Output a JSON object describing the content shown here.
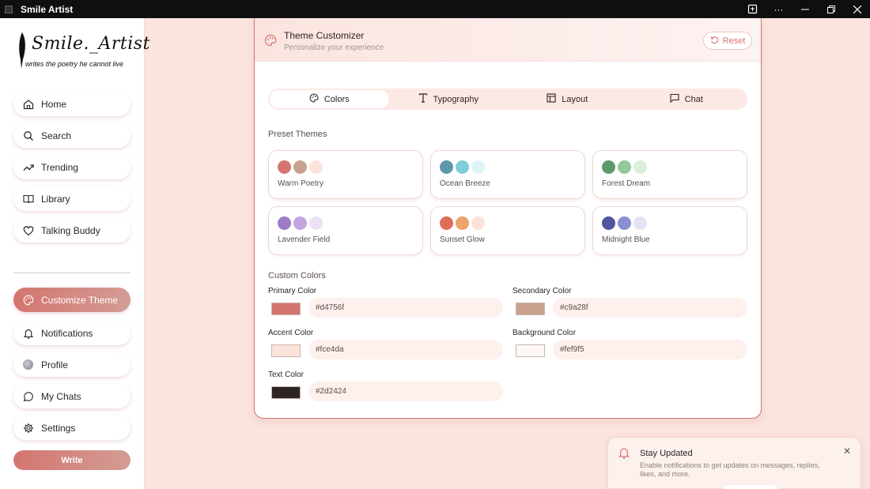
{
  "app": {
    "title": "Smile Artist"
  },
  "logo": {
    "main": "Smile._Artist",
    "tagline": "writes the poetry he cannot live"
  },
  "nav": [
    {
      "label": "Home",
      "icon": "home-icon"
    },
    {
      "label": "Search",
      "icon": "search-icon"
    },
    {
      "label": "Trending",
      "icon": "trending-icon"
    },
    {
      "label": "Library",
      "icon": "book-icon"
    },
    {
      "label": "Talking Buddy",
      "icon": "heart-icon"
    }
  ],
  "nav_bottom": [
    {
      "label": "Customize Theme",
      "icon": "palette-icon",
      "active": true
    },
    {
      "label": "Notifications",
      "icon": "bell-icon"
    },
    {
      "label": "Profile",
      "icon": "avatar"
    },
    {
      "label": "My Chats",
      "icon": "chat-icon"
    },
    {
      "label": "Settings",
      "icon": "gear-icon"
    }
  ],
  "write_label": "Write",
  "panel": {
    "title": "Theme Customizer",
    "subtitle": "Personalize your experience",
    "reset_label": "Reset",
    "tabs": [
      {
        "label": "Colors",
        "icon": "palette-icon",
        "active": true
      },
      {
        "label": "Typography",
        "icon": "type-icon"
      },
      {
        "label": "Layout",
        "icon": "layout-icon"
      },
      {
        "label": "Chat",
        "icon": "chat-icon"
      }
    ],
    "preset_heading": "Preset Themes",
    "presets": [
      {
        "name": "Warm Poetry",
        "colors": [
          "#d4756f",
          "#c9a28f",
          "#fce4da"
        ]
      },
      {
        "name": "Ocean Breeze",
        "colors": [
          "#5d98ad",
          "#7fcdd8",
          "#dff4f6"
        ]
      },
      {
        "name": "Forest Dream",
        "colors": [
          "#5e9a6c",
          "#93c79c",
          "#d9eedb"
        ]
      },
      {
        "name": "Lavender Field",
        "colors": [
          "#9e7cc7",
          "#c3a4df",
          "#ece0f6"
        ]
      },
      {
        "name": "Sunset Glow",
        "colors": [
          "#e06d58",
          "#eea36a",
          "#fce3d9"
        ]
      },
      {
        "name": "Midnight Blue",
        "colors": [
          "#5055a0",
          "#8a8fd1",
          "#e3e3f6"
        ]
      }
    ],
    "custom_heading": "Custom Colors",
    "custom": {
      "primary": {
        "label": "Primary Color",
        "value": "#d4756f"
      },
      "secondary": {
        "label": "Secondary Color",
        "value": "#c9a28f"
      },
      "accent": {
        "label": "Accent Color",
        "value": "#fce4da"
      },
      "background": {
        "label": "Background Color",
        "value": "#fef9f5"
      },
      "text": {
        "label": "Text Color",
        "value": "#2d2424"
      }
    }
  },
  "toast": {
    "title": "Stay Updated",
    "body": "Enable notifications to get updates on messages, replies, likes, and more.",
    "close": "✕"
  }
}
